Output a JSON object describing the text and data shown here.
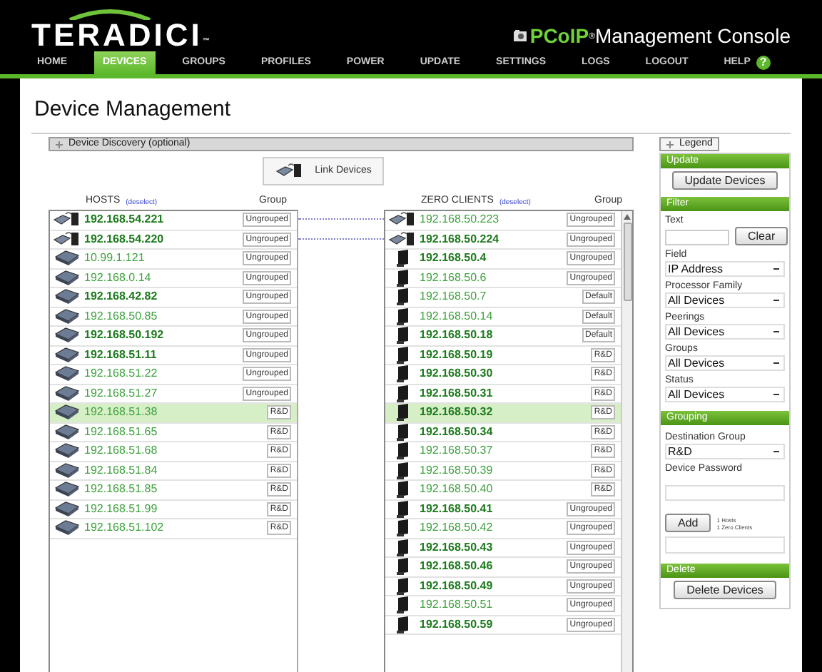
{
  "header": {
    "logo": "TERADICI",
    "logo_mark": "™",
    "product": {
      "brand": "PCoIP",
      "mark": "®",
      "title": "Management Console"
    }
  },
  "nav": [
    {
      "label": "HOME",
      "selected": false
    },
    {
      "label": "DEVICES",
      "selected": true
    },
    {
      "label": "GROUPS",
      "selected": false
    },
    {
      "label": "PROFILES",
      "selected": false
    },
    {
      "label": "POWER",
      "selected": false
    },
    {
      "label": "UPDATE",
      "selected": false
    },
    {
      "label": "SETTINGS",
      "selected": false
    },
    {
      "label": "LOGS",
      "selected": false
    },
    {
      "label": "LOGOUT",
      "selected": false
    },
    {
      "label": "HELP",
      "selected": false,
      "kind": "help",
      "icon": "?"
    }
  ],
  "page_title": "Device Management",
  "discovery": {
    "label": "Device Discovery (optional)",
    "expanded": false
  },
  "legend": {
    "label": "Legend",
    "expanded": false
  },
  "link_button": "Link Devices",
  "hosts": {
    "title": "HOSTS",
    "deselect": "(deselect)",
    "group_header": "Group",
    "rows": [
      {
        "ip": "192.168.54.221",
        "group": "Ungrouped",
        "kind": "linked",
        "online": true,
        "selected": false
      },
      {
        "ip": "192.168.54.220",
        "group": "Ungrouped",
        "kind": "linked",
        "online": true,
        "selected": false
      },
      {
        "ip": "10.99.1.121",
        "group": "Ungrouped",
        "kind": "host",
        "online": false,
        "selected": false
      },
      {
        "ip": "192.168.0.14",
        "group": "Ungrouped",
        "kind": "host",
        "online": false,
        "selected": false
      },
      {
        "ip": "192.168.42.82",
        "group": "Ungrouped",
        "kind": "host",
        "online": true,
        "selected": false
      },
      {
        "ip": "192.168.50.85",
        "group": "Ungrouped",
        "kind": "host",
        "online": false,
        "selected": false
      },
      {
        "ip": "192.168.50.192",
        "group": "Ungrouped",
        "kind": "host",
        "online": true,
        "selected": false
      },
      {
        "ip": "192.168.51.11",
        "group": "Ungrouped",
        "kind": "host",
        "online": true,
        "selected": false
      },
      {
        "ip": "192.168.51.22",
        "group": "Ungrouped",
        "kind": "host",
        "online": false,
        "selected": false
      },
      {
        "ip": "192.168.51.27",
        "group": "Ungrouped",
        "kind": "host",
        "online": false,
        "selected": false
      },
      {
        "ip": "192.168.51.38",
        "group": "R&D",
        "kind": "host",
        "online": false,
        "selected": true
      },
      {
        "ip": "192.168.51.65",
        "group": "R&D",
        "kind": "host",
        "online": false,
        "selected": false
      },
      {
        "ip": "192.168.51.68",
        "group": "R&D",
        "kind": "host",
        "online": false,
        "selected": false
      },
      {
        "ip": "192.168.51.84",
        "group": "R&D",
        "kind": "host",
        "online": false,
        "selected": false
      },
      {
        "ip": "192.168.51.85",
        "group": "R&D",
        "kind": "host",
        "online": false,
        "selected": false
      },
      {
        "ip": "192.168.51.99",
        "group": "R&D",
        "kind": "host",
        "online": false,
        "selected": false
      },
      {
        "ip": "192.168.51.102",
        "group": "R&D",
        "kind": "host",
        "online": false,
        "selected": false
      }
    ]
  },
  "clients": {
    "title": "ZERO CLIENTS",
    "deselect": "(deselect)",
    "group_header": "Group",
    "rows": [
      {
        "ip": "192.168.50.223",
        "group": "Ungrouped",
        "kind": "linked",
        "online": false,
        "selected": false
      },
      {
        "ip": "192.168.50.224",
        "group": "Ungrouped",
        "kind": "linked",
        "online": true,
        "selected": false
      },
      {
        "ip": "192.168.50.4",
        "group": "Ungrouped",
        "kind": "client",
        "online": true,
        "selected": false
      },
      {
        "ip": "192.168.50.6",
        "group": "Ungrouped",
        "kind": "client",
        "online": false,
        "selected": false
      },
      {
        "ip": "192.168.50.7",
        "group": "Default",
        "kind": "client",
        "online": false,
        "selected": false
      },
      {
        "ip": "192.168.50.14",
        "group": "Default",
        "kind": "client",
        "online": false,
        "selected": false
      },
      {
        "ip": "192.168.50.18",
        "group": "Default",
        "kind": "client",
        "online": true,
        "selected": false
      },
      {
        "ip": "192.168.50.19",
        "group": "R&D",
        "kind": "client",
        "online": true,
        "selected": false
      },
      {
        "ip": "192.168.50.30",
        "group": "R&D",
        "kind": "client",
        "online": true,
        "selected": false
      },
      {
        "ip": "192.168.50.31",
        "group": "R&D",
        "kind": "client",
        "online": true,
        "selected": false
      },
      {
        "ip": "192.168.50.32",
        "group": "R&D",
        "kind": "client",
        "online": true,
        "selected": true
      },
      {
        "ip": "192.168.50.34",
        "group": "R&D",
        "kind": "client",
        "online": true,
        "selected": false
      },
      {
        "ip": "192.168.50.37",
        "group": "R&D",
        "kind": "client",
        "online": false,
        "selected": false
      },
      {
        "ip": "192.168.50.39",
        "group": "R&D",
        "kind": "client",
        "online": false,
        "selected": false
      },
      {
        "ip": "192.168.50.40",
        "group": "R&D",
        "kind": "client",
        "online": false,
        "selected": false
      },
      {
        "ip": "192.168.50.41",
        "group": "Ungrouped",
        "kind": "client",
        "online": true,
        "selected": false
      },
      {
        "ip": "192.168.50.42",
        "group": "Ungrouped",
        "kind": "client",
        "online": false,
        "selected": false
      },
      {
        "ip": "192.168.50.43",
        "group": "Ungrouped",
        "kind": "client",
        "online": true,
        "selected": false
      },
      {
        "ip": "192.168.50.46",
        "group": "Ungrouped",
        "kind": "client",
        "online": true,
        "selected": false
      },
      {
        "ip": "192.168.50.49",
        "group": "Ungrouped",
        "kind": "client",
        "online": true,
        "selected": false
      },
      {
        "ip": "192.168.50.51",
        "group": "Ungrouped",
        "kind": "client",
        "online": false,
        "selected": false
      },
      {
        "ip": "192.168.50.59",
        "group": "Ungrouped",
        "kind": "client",
        "online": true,
        "selected": false
      }
    ]
  },
  "sidebar": {
    "update": {
      "title": "Update",
      "button": "Update Devices"
    },
    "filter": {
      "title": "Filter",
      "text_label": "Text",
      "clear": "Clear",
      "selects": [
        {
          "label": "Field",
          "value": "IP Address"
        },
        {
          "label": "Processor Family",
          "value": "All Devices"
        },
        {
          "label": "Peerings",
          "value": "All Devices"
        },
        {
          "label": "Groups",
          "value": "All Devices"
        },
        {
          "label": "Status",
          "value": "All Devices"
        }
      ]
    },
    "grouping": {
      "title": "Grouping",
      "dest_label": "Destination Group",
      "dest_value": "R&D",
      "password_label": "Device Password",
      "add": "Add",
      "counts": [
        "1 Hosts",
        "1 Zero Clients"
      ]
    },
    "delete": {
      "title": "Delete",
      "button": "Delete Devices"
    }
  }
}
